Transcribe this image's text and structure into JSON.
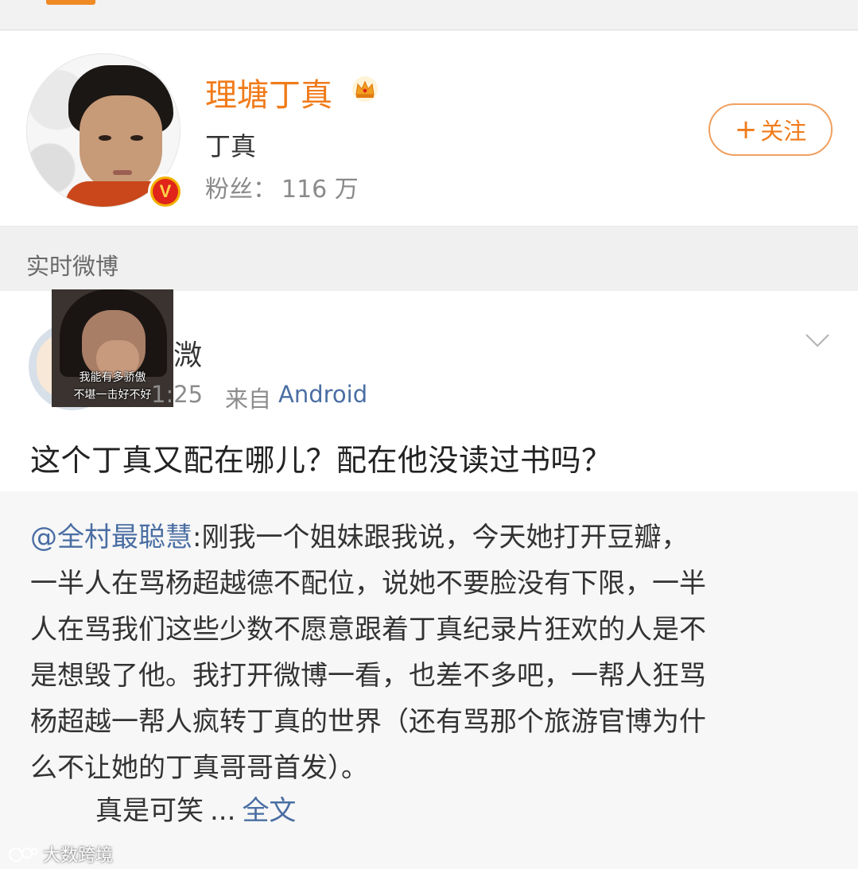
{
  "profile": {
    "display_name": "理塘丁真",
    "real_name": "丁真",
    "fans_label": "粉丝：",
    "fans_count": "116 万",
    "follow_label": "关注",
    "follow_plus": "+",
    "verified_mark": "V"
  },
  "section": {
    "title": "实时微博"
  },
  "post": {
    "author_visible": "溦",
    "time": "1:25",
    "source_label": "来自",
    "source": "Android",
    "text": "这个丁真又配在哪儿？配在他没读过书吗？",
    "meme_caption_1": "我能有多骄傲",
    "meme_caption_2": "不堪一击好不好"
  },
  "repost": {
    "mention": "@全村最聪慧",
    "line1_rest": ":刚我一个姐妹跟我说，今天她打开豆瓣，",
    "line2": "一半人在骂杨超越德不配位，说她不要脸没有下限，一半",
    "line3": "人在骂我们这些少数不愿意跟着丁真纪录片狂欢的人是不",
    "line4": "是想毁了他。我打开微博一看，也差不多吧，一帮人狂骂",
    "line5": "杨超越一帮人疯转丁真的世界（还有骂那个旅游官博为什",
    "line6": "么不让她的丁真哥哥首发）。",
    "line7": "真是可笑",
    "ellipsis": "...",
    "full_text_link": "全文"
  },
  "watermark": {
    "text": "大数跨境"
  },
  "colors": {
    "accent_orange": "#f07b1a",
    "link_blue": "#4a6ea3",
    "badge_red": "#e0241a",
    "badge_gold": "#f2b000"
  }
}
